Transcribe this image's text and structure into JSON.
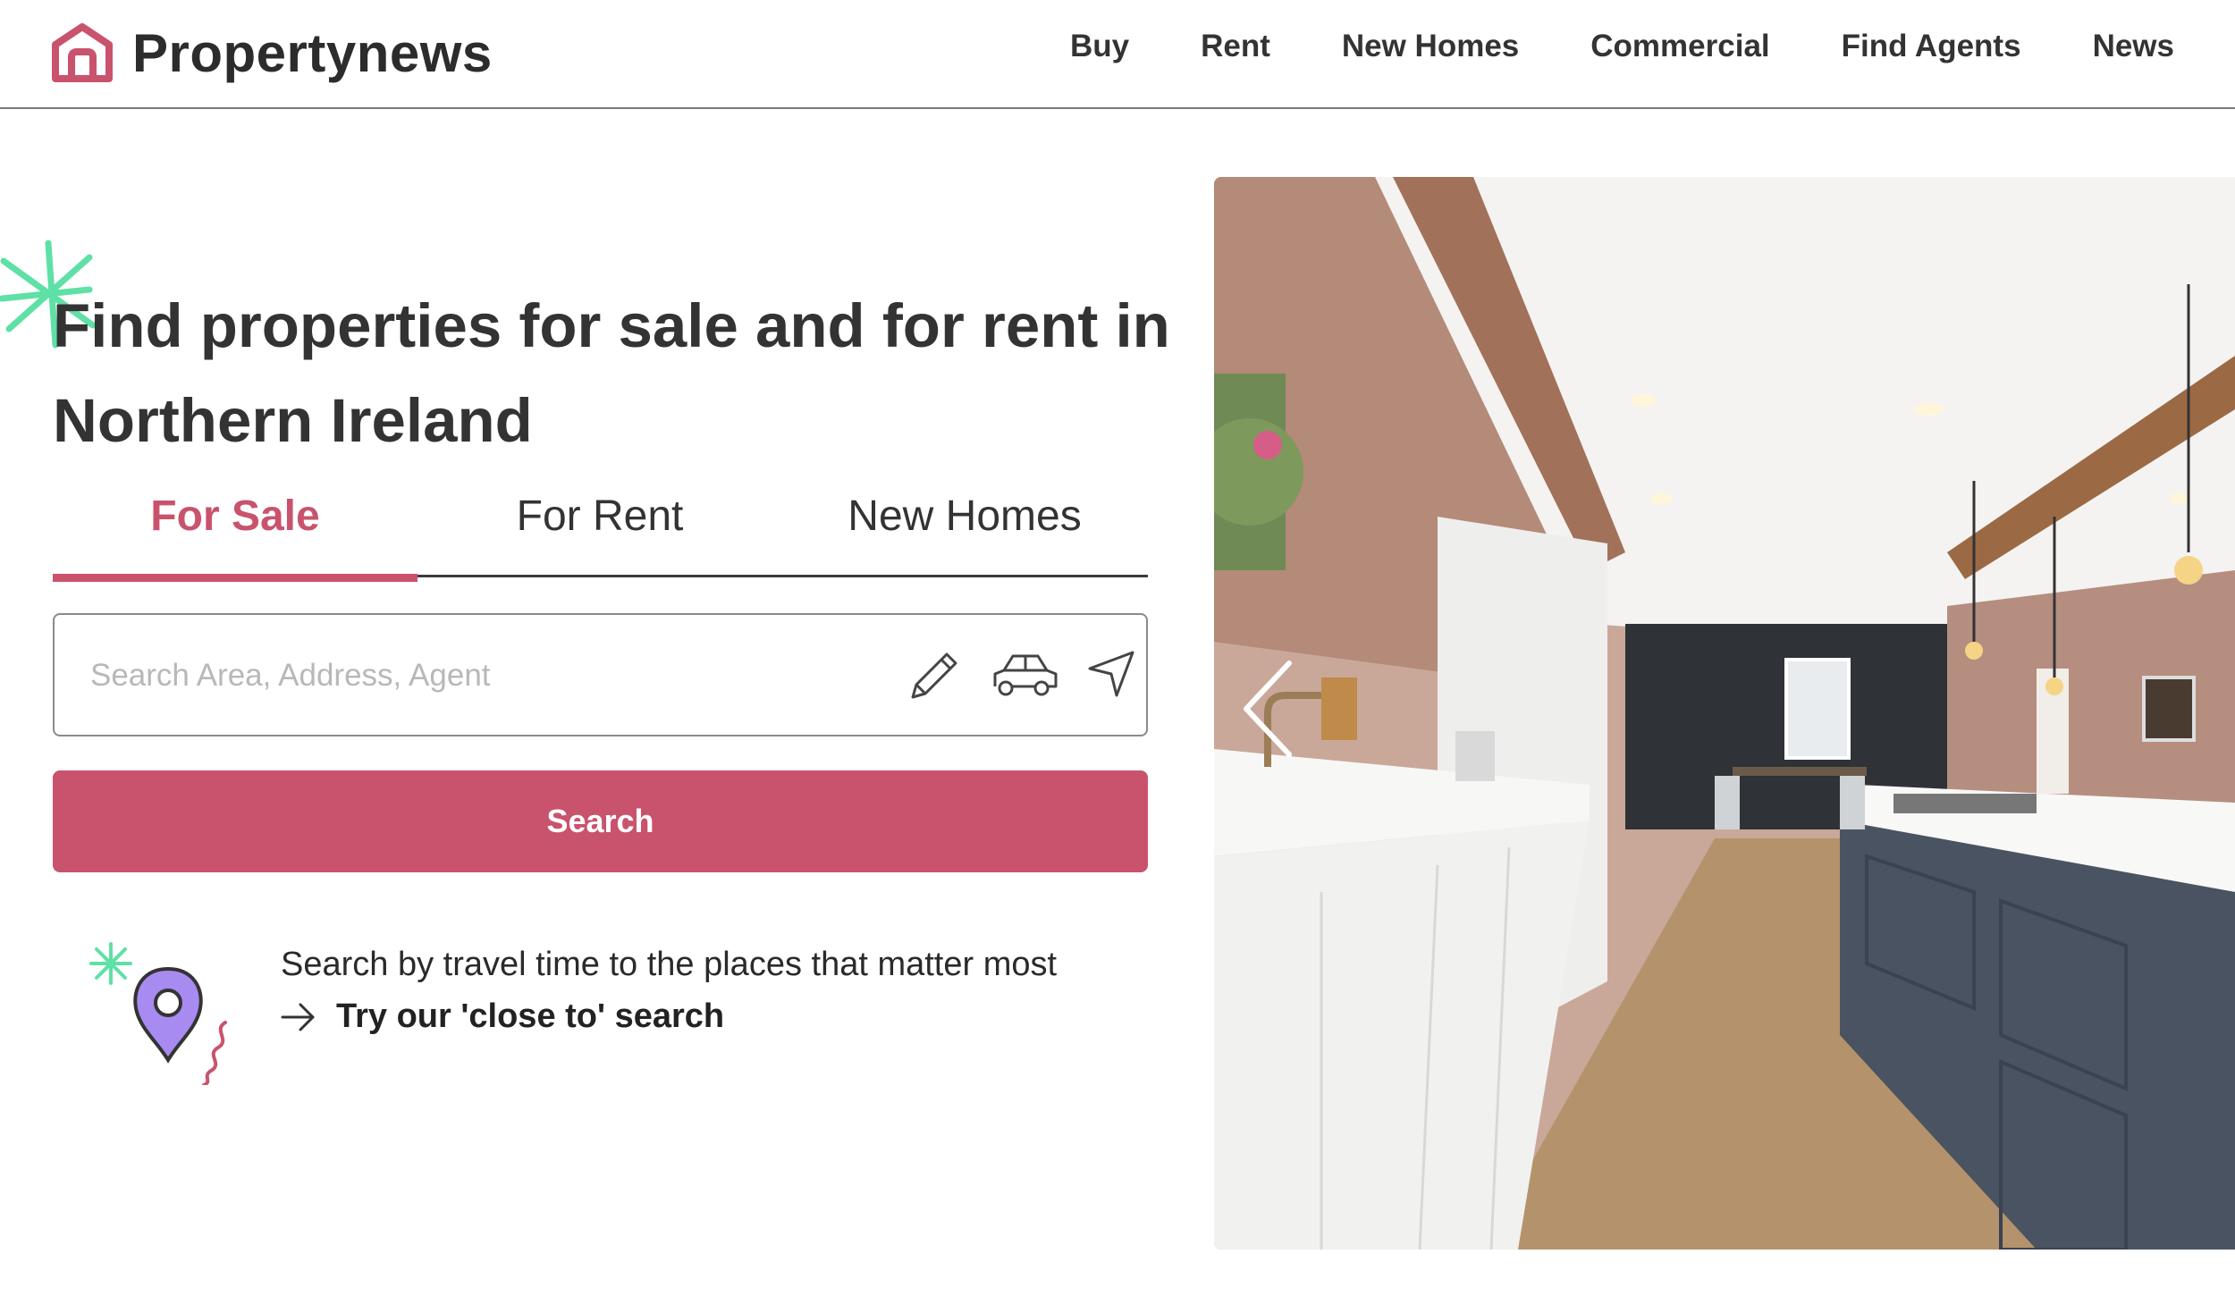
{
  "header": {
    "logo_text": "Propertynews",
    "nav": [
      "Buy",
      "Rent",
      "New Homes",
      "Commercial",
      "Find Agents",
      "News"
    ]
  },
  "hero": {
    "headline": "Find properties for sale and for rent in Northern Ireland"
  },
  "tabs": [
    {
      "label": "For Sale",
      "active": true
    },
    {
      "label": "For Rent",
      "active": false
    },
    {
      "label": "New Homes",
      "active": false
    }
  ],
  "search": {
    "placeholder": "Search Area, Address, Agent",
    "value": "",
    "button_label": "Search",
    "icons": [
      "pencil-icon",
      "car-icon",
      "location-arrow-icon"
    ]
  },
  "travel": {
    "text": "Search by travel time to the places that matter most",
    "link_label": "Try our 'close to' search"
  },
  "colors": {
    "brand": "#c9536d",
    "sparkle": "#5fe0a6",
    "pin": "#a78bf0",
    "text": "#333333"
  },
  "carousel": {
    "image": "kitchen-photo",
    "prev_icon": "chevron-left-icon"
  }
}
